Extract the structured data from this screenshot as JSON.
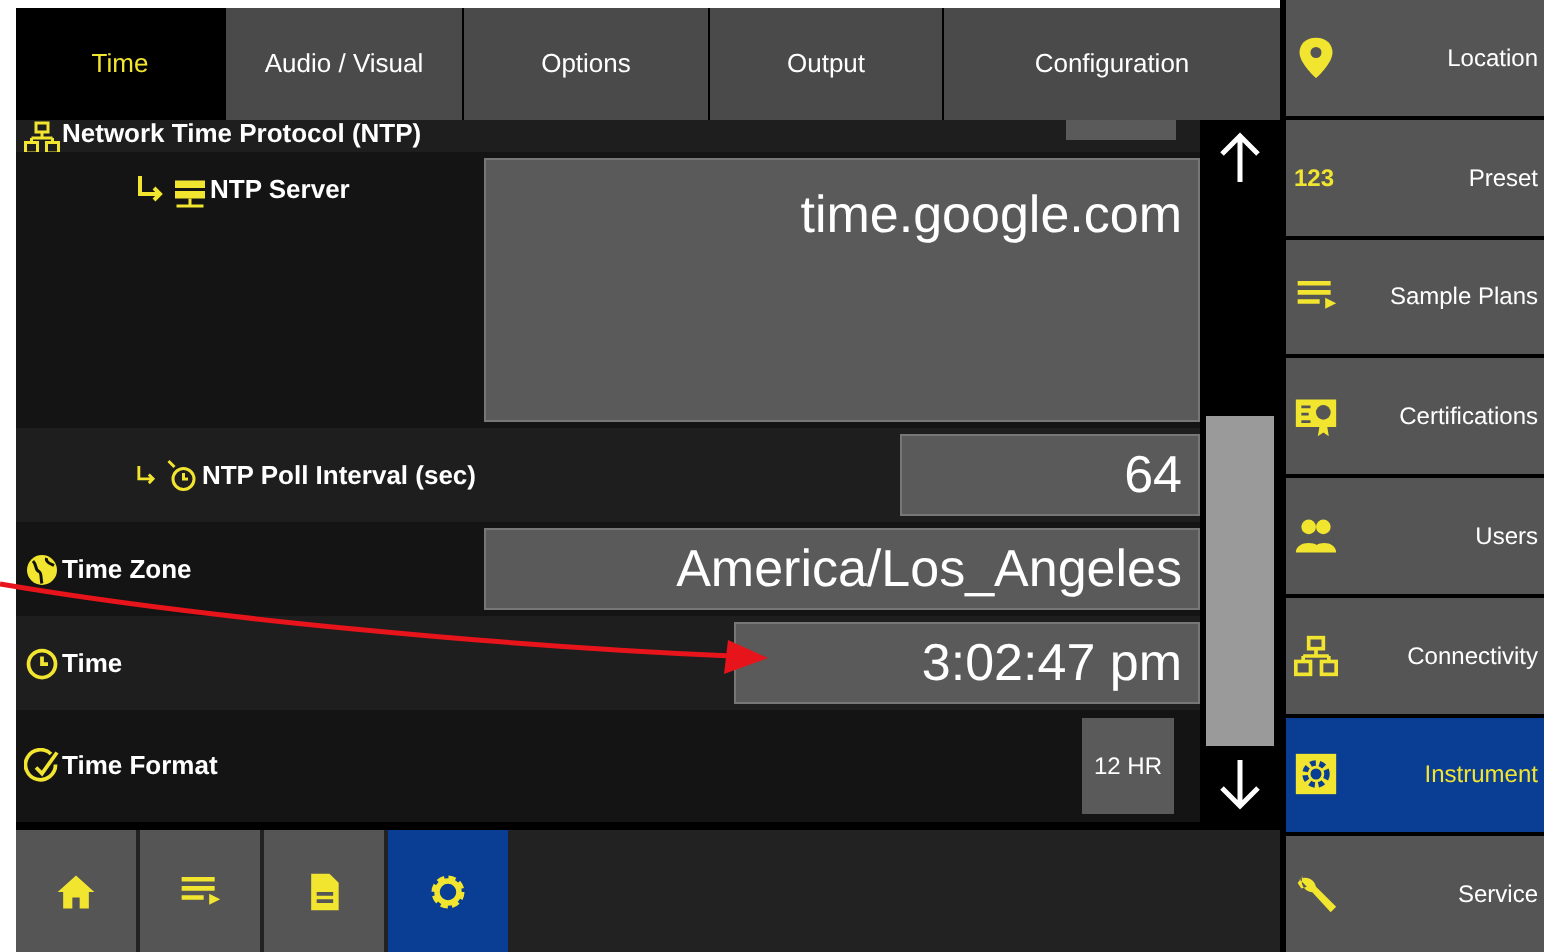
{
  "tabs": [
    {
      "label": "Time",
      "selected": true
    },
    {
      "label": "Audio / Visual",
      "selected": false
    },
    {
      "label": "Options",
      "selected": false
    },
    {
      "label": "Output",
      "selected": false
    },
    {
      "label": "Configuration",
      "selected": false
    }
  ],
  "settings": [
    {
      "kind": "header",
      "label": "Network Time Protocol (NTP)",
      "children": [
        {
          "kind": "field",
          "label": "NTP Server",
          "value": "time.google.com"
        },
        {
          "kind": "field",
          "label": "NTP Poll Interval (sec)",
          "value": "64"
        }
      ]
    },
    {
      "kind": "field",
      "label": "Time Zone",
      "value": "America/Los_Angeles"
    },
    {
      "kind": "field",
      "label": "Time",
      "value": "3:02:47 pm"
    },
    {
      "kind": "button",
      "label": "Time Format",
      "value": "12 HR"
    }
  ],
  "sidebar": [
    {
      "label": "Location",
      "selected": false
    },
    {
      "icon_text": "123",
      "label": "Preset",
      "selected": false
    },
    {
      "label": "Sample Plans",
      "selected": false
    },
    {
      "label": "Certifications",
      "selected": false
    },
    {
      "label": "Users",
      "selected": false
    },
    {
      "label": "Connectivity",
      "selected": false
    },
    {
      "label": "Instrument",
      "selected": true
    },
    {
      "label": "Service",
      "selected": false
    }
  ],
  "bottom_bar": [
    {
      "selected": false
    },
    {
      "selected": false
    },
    {
      "selected": false
    },
    {
      "selected": true
    }
  ]
}
